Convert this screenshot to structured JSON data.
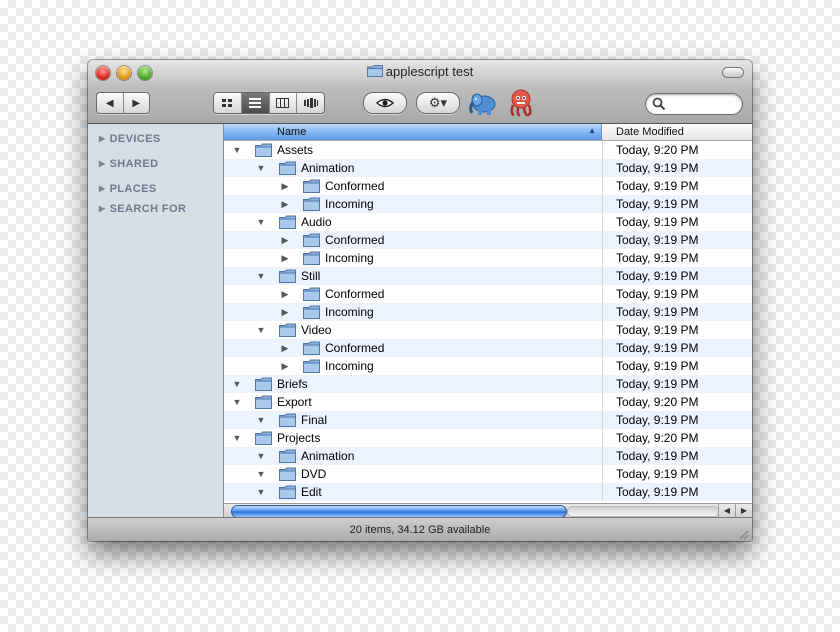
{
  "window": {
    "title": "applescript test",
    "status": "20 items, 34.12 GB available"
  },
  "toolbar": {
    "back_glyph": "◀",
    "forward_glyph": "▶",
    "view_modes": [
      "icon-view",
      "list-view",
      "column-view",
      "coverflow-view"
    ],
    "selected_view": "list-view",
    "action_glyph": "⚙▾",
    "extension_icons": [
      "elephant-icon",
      "octopus-icon"
    ],
    "search": {
      "value": "",
      "placeholder": ""
    }
  },
  "sidebar": {
    "sections": [
      {
        "label": "DEVICES"
      },
      {
        "label": "SHARED"
      },
      {
        "label": "PLACES"
      },
      {
        "label": "SEARCH FOR"
      }
    ]
  },
  "list": {
    "columns": {
      "name": "Name",
      "date": "Date Modified"
    },
    "sort_indicator": "▲",
    "rows": [
      {
        "name": "Assets",
        "date": "Today, 9:20 PM",
        "level": 0,
        "expanded": true
      },
      {
        "name": "Animation",
        "date": "Today, 9:19 PM",
        "level": 1,
        "expanded": true
      },
      {
        "name": "Conformed",
        "date": "Today, 9:19 PM",
        "level": 2,
        "expanded": false
      },
      {
        "name": "Incoming",
        "date": "Today, 9:19 PM",
        "level": 2,
        "expanded": false
      },
      {
        "name": "Audio",
        "date": "Today, 9:19 PM",
        "level": 1,
        "expanded": true
      },
      {
        "name": "Conformed",
        "date": "Today, 9:19 PM",
        "level": 2,
        "expanded": false
      },
      {
        "name": "Incoming",
        "date": "Today, 9:19 PM",
        "level": 2,
        "expanded": false
      },
      {
        "name": "Still",
        "date": "Today, 9:19 PM",
        "level": 1,
        "expanded": true
      },
      {
        "name": "Conformed",
        "date": "Today, 9:19 PM",
        "level": 2,
        "expanded": false
      },
      {
        "name": "Incoming",
        "date": "Today, 9:19 PM",
        "level": 2,
        "expanded": false
      },
      {
        "name": "Video",
        "date": "Today, 9:19 PM",
        "level": 1,
        "expanded": true
      },
      {
        "name": "Conformed",
        "date": "Today, 9:19 PM",
        "level": 2,
        "expanded": false
      },
      {
        "name": "Incoming",
        "date": "Today, 9:19 PM",
        "level": 2,
        "expanded": false
      },
      {
        "name": "Briefs",
        "date": "Today, 9:19 PM",
        "level": 0,
        "expanded": true
      },
      {
        "name": "Export",
        "date": "Today, 9:20 PM",
        "level": 0,
        "expanded": true
      },
      {
        "name": "Final",
        "date": "Today, 9:19 PM",
        "level": 1,
        "expanded": true
      },
      {
        "name": "Projects",
        "date": "Today, 9:20 PM",
        "level": 0,
        "expanded": true
      },
      {
        "name": "Animation",
        "date": "Today, 9:19 PM",
        "level": 1,
        "expanded": true
      },
      {
        "name": "DVD",
        "date": "Today, 9:19 PM",
        "level": 1,
        "expanded": true
      },
      {
        "name": "Edit",
        "date": "Today, 9:19 PM",
        "level": 1,
        "expanded": true
      }
    ]
  },
  "colors": {
    "row_alt": "#edf3fe",
    "sidebar_bg": "#d6dde5",
    "sidebar_text": "#6d7c8c",
    "header_selected": "#7fb2ee",
    "folder_blue": "#8fb4dc",
    "scroll_thumb": "#3a86e0"
  }
}
